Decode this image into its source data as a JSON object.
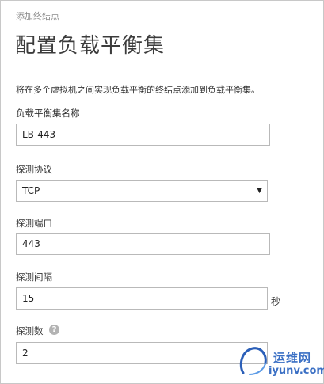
{
  "breadcrumb": "添加终结点",
  "title": "配置负载平衡集",
  "description": "将在多个虚拟机之间实现负载平衡的终结点添加到负载平衡集。",
  "fields": {
    "name": {
      "label": "负载平衡集名称",
      "value": "LB-443"
    },
    "protocol": {
      "label": "探测协议",
      "value": "TCP"
    },
    "port": {
      "label": "探测端口",
      "value": "443"
    },
    "interval": {
      "label": "探测间隔",
      "value": "15",
      "unit": "秒"
    },
    "count": {
      "label": "探测数",
      "value": "2"
    }
  },
  "icons": {
    "dropdown": "chevron-down-icon",
    "help": "question-icon"
  },
  "help_glyph": "?",
  "watermark": {
    "line1": "运维网",
    "line2": "iyunv.com"
  },
  "colors": {
    "title": "#3c3c3c",
    "border": "#b9b9b9",
    "help": "#b3b3b3",
    "watermark": "#3a6fc4"
  }
}
